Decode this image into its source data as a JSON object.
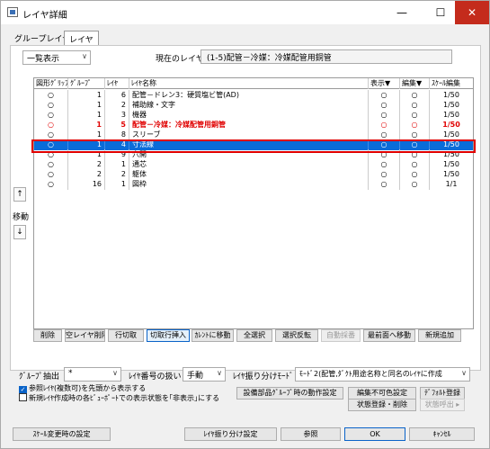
{
  "window": {
    "title": "レイヤ詳細",
    "minimize": "—",
    "maximize": "☐",
    "close": "✕"
  },
  "tabs": [
    "グループレイヤ",
    "レイヤ"
  ],
  "view_select": "一覧表示",
  "current_layer": {
    "label": "現在のレイヤ",
    "value": "(1-5)配管－冷媒：冷媒配管用銅管"
  },
  "grid": {
    "headers": {
      "figure": "図形ｸﾞﾘｯﾌﾟ",
      "group": "ｸﾞﾙｰﾌﾟ",
      "layer": "ﾚｲﾔ",
      "name": "ﾚｲﾔ名称",
      "display": "表示▼",
      "edit": "編集▼",
      "scale": "ｽｹｰﾙ編集"
    },
    "rows": [
      {
        "figure": "○",
        "group": "1",
        "layer": "6",
        "name": "配管－ドレン3：硬質塩ビ管(AD)",
        "display": "○",
        "edit": "○",
        "scale": "1/50"
      },
      {
        "figure": "○",
        "group": "1",
        "layer": "2",
        "name": "補助線・文字",
        "display": "○",
        "edit": "○",
        "scale": "1/50"
      },
      {
        "figure": "○",
        "group": "1",
        "layer": "3",
        "name": "機器",
        "display": "○",
        "edit": "○",
        "scale": "1/50"
      },
      {
        "figure": "○",
        "group": "1",
        "layer": "5",
        "name": "配管－冷媒：冷媒配管用銅管",
        "display": "○",
        "edit": "○",
        "scale": "1/50"
      },
      {
        "figure": "○",
        "group": "1",
        "layer": "8",
        "name": "スリーブ",
        "display": "○",
        "edit": "○",
        "scale": "1/50"
      },
      {
        "figure": "○",
        "group": "1",
        "layer": "4",
        "name": "寸法線",
        "display": "○",
        "edit": "○",
        "scale": "1/50"
      },
      {
        "figure": "○",
        "group": "1",
        "layer": "9",
        "name": "穴開",
        "display": "○",
        "edit": "○",
        "scale": "1/50"
      },
      {
        "figure": "○",
        "group": "2",
        "layer": "1",
        "name": "通芯",
        "display": "○",
        "edit": "○",
        "scale": "1/50"
      },
      {
        "figure": "○",
        "group": "2",
        "layer": "2",
        "name": "躯体",
        "display": "○",
        "edit": "○",
        "scale": "1/50"
      },
      {
        "figure": "○",
        "group": "16",
        "layer": "1",
        "name": "図枠",
        "display": "○",
        "edit": "○",
        "scale": "1/1"
      }
    ]
  },
  "move": {
    "up": "↑",
    "label": "移動",
    "down": "↓"
  },
  "buttons_row1": [
    "削除",
    "空レイヤ削除",
    "行切取",
    "切取行挿入",
    "ｶﾚﾝﾄに移動",
    "全選択",
    "選択反転",
    "自動採番",
    "最前面へ移動",
    "新規追加"
  ],
  "group_extract": {
    "label": "ｸﾞﾙｰﾌﾟ抽出",
    "value": "*"
  },
  "layer_number": {
    "label": "ﾚｲﾔ番号の扱い",
    "value": "手動"
  },
  "layer_split_mode": {
    "label": "ﾚｲﾔ振り分けﾓｰﾄﾞ",
    "value": "ﾓｰﾄﾞ2(配管,ﾀﾞｸﾄ用途名称と同名のﾚｲﾔに作成"
  },
  "checkbox1": {
    "label": "参照ﾚｲﾔ(複数可)を先頭から表示する",
    "checked": true
  },
  "checkbox2": {
    "label": "新規ﾚｲﾔ作成時の各ﾋﾞｭｰﾎﾟｰﾄでの表示状態を｢非表示｣にする",
    "checked": false
  },
  "buttons_row2": [
    "設備部品ｸﾞﾙｰﾌﾟ時の動作設定",
    "編集不可色設定",
    "ﾃﾞﾌｫﾙﾄ登録"
  ],
  "buttons_row3": [
    "状態登録・削除",
    "状態呼出 ▸"
  ],
  "footer": [
    "ｽｹｰﾙ変更時の設定",
    "ﾚｲﾔ振り分け設定",
    "参照",
    "OK",
    "ｷｬﾝｾﾙ"
  ]
}
